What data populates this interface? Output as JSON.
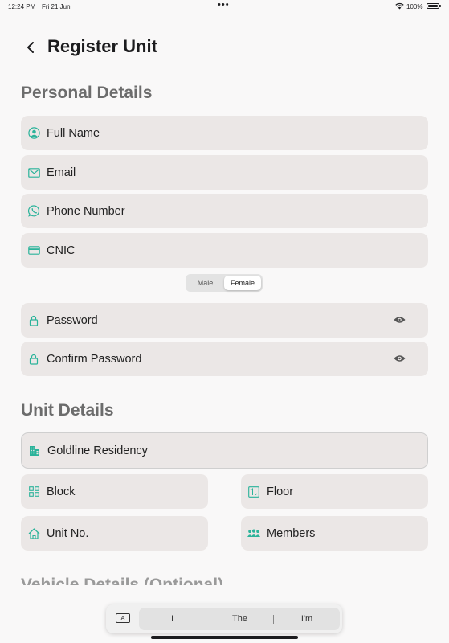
{
  "status_bar": {
    "time": "12:24 PM",
    "date": "Fri 21 Jun",
    "battery": "100%"
  },
  "header": {
    "title": "Register Unit"
  },
  "personal": {
    "section_title": "Personal Details",
    "full_name": "Full Name",
    "email": "Email",
    "phone": "Phone Number",
    "cnic": "CNIC",
    "gender": {
      "male": "Male",
      "female": "Female",
      "selected": "Female"
    },
    "password": "Password",
    "confirm_password": "Confirm Password"
  },
  "unit": {
    "section_title": "Unit Details",
    "residency": "Goldline Residency",
    "block": "Block",
    "floor": "Floor",
    "unit_no": "Unit No.",
    "members": "Members"
  },
  "vehicle": {
    "section_title": "Vehicle Details (Optional)"
  },
  "keyboard": {
    "toggle": "A",
    "suggestions": [
      "I",
      "The",
      "I'm"
    ]
  },
  "colors": {
    "accent": "#2bb39a",
    "field_bg": "#ebe7e6",
    "section_title": "#6c6c6c"
  },
  "icons": [
    "chevron-left-icon",
    "person-circle-icon",
    "envelope-icon",
    "whatsapp-icon",
    "credit-card-icon",
    "lock-icon",
    "eye-icon",
    "building-icon",
    "grid-icon",
    "floor-icon",
    "home-icon",
    "people-icon",
    "wifi-icon",
    "battery-icon"
  ]
}
